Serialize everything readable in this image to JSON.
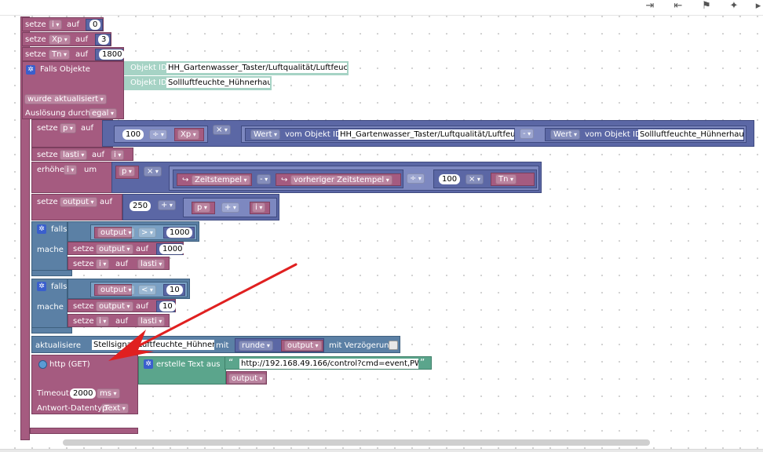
{
  "toolbar": {
    "icons": [
      "export-icon",
      "import-icon",
      "flag-icon",
      "magic-wand-icon",
      "download-icon"
    ]
  },
  "blocks": {
    "set_i": {
      "setze": "setze",
      "var": "i",
      "auf": "auf",
      "value": "0"
    },
    "set_xp": {
      "setze": "setze",
      "var": "Xp",
      "auf": "auf",
      "value": "3"
    },
    "set_tn": {
      "setze": "setze",
      "var": "Tn",
      "auf": "auf",
      "value": "1800"
    },
    "trigger": {
      "title": "Falls Objekte",
      "obj_label_1": "Objekt ID",
      "obj_value_1": "HH_Gartenwasser_Taster/Luftqualität/Luftfeuchte",
      "obj_label_2": "Objekt ID",
      "obj_value_2": "Sollluftfeuchte_Hühnerhaus",
      "condition": "wurde aktualisiert",
      "trigger_label": "Auslösung durch",
      "trigger_value": "egal"
    },
    "set_p": {
      "setze": "setze",
      "var": "p",
      "auf": "auf",
      "num": "100",
      "op_div": "÷",
      "xp": "Xp",
      "op_mul": "×",
      "wert1": "Wert",
      "vom1": "vom Objekt ID",
      "obj1": "HH_Gartenwasser_Taster/Luftqualität/Luftfeuchte",
      "op_minus": "-",
      "wert2": "Wert",
      "vom2": "vom Objekt ID",
      "obj2": "Sollluftfeuchte_Hühnerhaus"
    },
    "set_lasti": {
      "setze": "setze",
      "var": "lasti",
      "auf": "auf",
      "value": "i"
    },
    "incr_i": {
      "erhohe": "erhöhe",
      "var": "i",
      "um": "um",
      "p": "p",
      "op_mul": "×",
      "ts1": "Zeitstempel",
      "op_minus": "-",
      "ts2": "vorheriger Zeitstempel",
      "op_div": "÷",
      "num": "100",
      "op_mul2": "×",
      "tn": "Tn"
    },
    "set_output": {
      "setze": "setze",
      "var": "output",
      "auf": "auf",
      "num": "250",
      "op_plus": "+",
      "p": "p",
      "op_plus2": "+",
      "i": "i"
    },
    "if1": {
      "falls": "falls",
      "mache": "mache",
      "lhs": "output",
      "op": ">",
      "rhs": "1000",
      "s1_setze": "setze",
      "s1_var": "output",
      "s1_auf": "auf",
      "s1_val": "1000",
      "s2_setze": "setze",
      "s2_var": "i",
      "s2_auf": "auf",
      "s2_val": "lasti"
    },
    "if2": {
      "falls": "falls",
      "mache": "mache",
      "lhs": "output",
      "op": "<",
      "rhs": "10",
      "s1_setze": "setze",
      "s1_var": "output",
      "s1_auf": "auf",
      "s1_val": "10",
      "s2_setze": "setze",
      "s2_var": "i",
      "s2_auf": "auf",
      "s2_val": "lasti"
    },
    "update": {
      "label": "aktualisiere",
      "target": "Stellsignal_Luftfeuchte_Hühnerhaus",
      "mit": "mit",
      "runde": "runde",
      "output": "output",
      "verz": "mit Verzögerung"
    },
    "http": {
      "label": "http (GET)",
      "text_label": "erstelle Text aus",
      "quote_open": "“",
      "url": "http://192.168.49.166/control?cmd=event,PWM=",
      "quote_close": "”",
      "output": "output",
      "timeout_label": "Timeout",
      "timeout_value": "2000",
      "timeout_unit": "ms",
      "resp_label": "Antwort-Datentyp",
      "resp_value": "Text"
    }
  },
  "colors": {
    "variable": "#a55b80",
    "math": "#5b67a5",
    "logic": "#5b80a5",
    "text": "#5ba58c",
    "object": "#a6d3c5",
    "annotation_arrow": "#e02020"
  }
}
